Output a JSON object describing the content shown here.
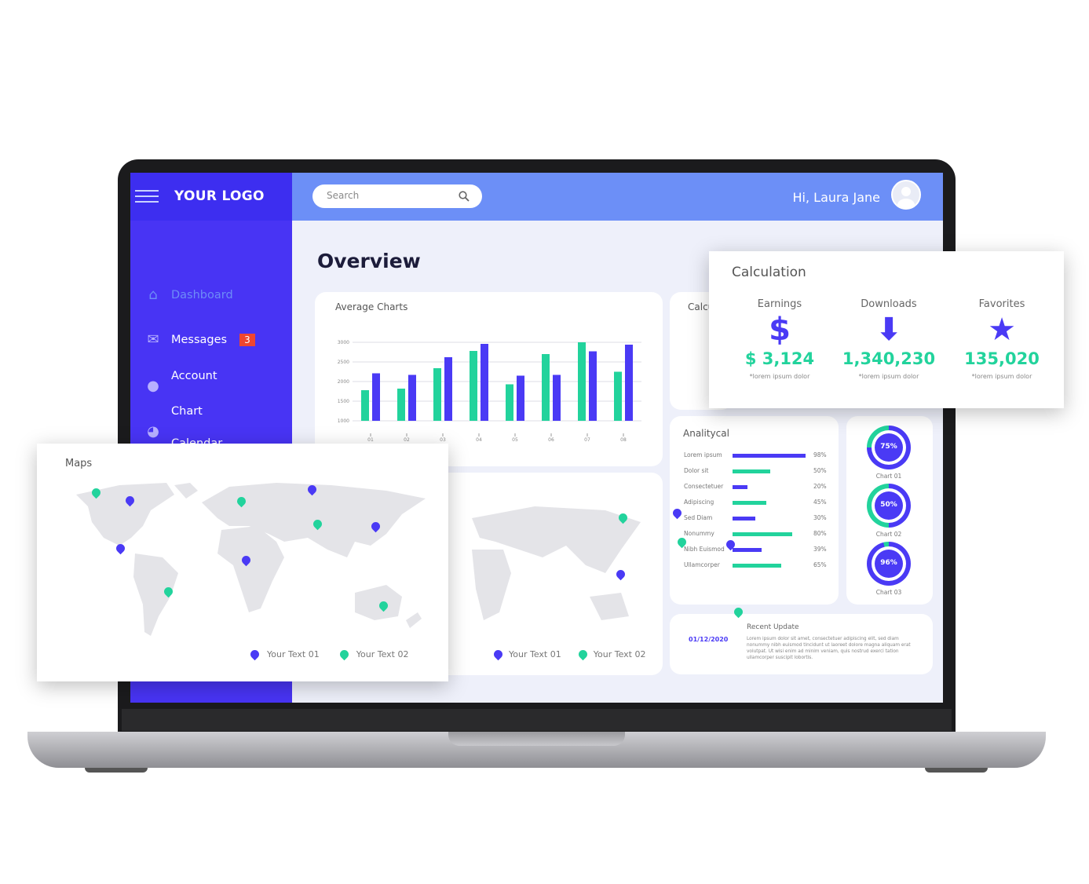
{
  "colors": {
    "primary": "#4a3af5",
    "accent": "#22d39c",
    "sidebar": "#4834f4",
    "topbar": "#6c8ff7",
    "badge": "#f0452f"
  },
  "header": {
    "logo": "YOUR LOGO",
    "search_placeholder": "Search",
    "greeting": "Hi, Laura Jane"
  },
  "sidebar": {
    "items": [
      {
        "label": "Dashboard",
        "icon": "home-icon"
      },
      {
        "label": "Messages",
        "icon": "mail-icon",
        "badge": "3"
      },
      {
        "label": "Account",
        "icon": "user-icon"
      },
      {
        "label": "Chart",
        "icon": "pie-chart-icon"
      },
      {
        "label": "Calendar",
        "icon": "calendar-icon"
      }
    ]
  },
  "main": {
    "title": "Overview"
  },
  "average_chart": {
    "title": "Average Charts"
  },
  "chart_data": {
    "type": "bar",
    "title": "Average Charts",
    "categories": [
      "01",
      "02",
      "03",
      "04",
      "05",
      "06",
      "07",
      "08"
    ],
    "series": [
      {
        "color": "#22d39c",
        "values": [
          1780,
          1820,
          2340,
          2780,
          1930,
          2700,
          3000,
          2250
        ]
      },
      {
        "color": "#4a3af5",
        "values": [
          2210,
          2170,
          2620,
          2960,
          2150,
          2170,
          2770,
          2940
        ]
      }
    ],
    "yticks": [
      3000,
      2500,
      2000,
      1500,
      1000
    ],
    "ylim": [
      1000,
      3000
    ],
    "grid": true
  },
  "calculation": {
    "title": "Calculation",
    "back_title": "Calcu",
    "items": [
      {
        "label": "Earnings",
        "icon": "dollar-icon",
        "glyph": "$",
        "value": "$ 3,124",
        "note": "*lorem ipsum dolor"
      },
      {
        "label": "Downloads",
        "icon": "download-arrow-icon",
        "glyph": "⬇",
        "value": "1,340,230",
        "note": "*lorem ipsum dolor"
      },
      {
        "label": "Favorites",
        "icon": "star-icon",
        "glyph": "★",
        "value": "135,020",
        "note": "*lorem ipsum dolor"
      }
    ]
  },
  "analytical": {
    "title": "Analitycal",
    "rows": [
      {
        "label": "Lorem ipsum",
        "value": 98,
        "text": "98%",
        "color": "#4a3af5"
      },
      {
        "label": "Dolor sit",
        "value": 50,
        "text": "50%",
        "color": "#22d39c"
      },
      {
        "label": "Consectetuer",
        "value": 20,
        "text": "20%",
        "color": "#4a3af5"
      },
      {
        "label": "Adipiscing",
        "value": 45,
        "text": "45%",
        "color": "#22d39c"
      },
      {
        "label": "Sed Diam",
        "value": 30,
        "text": "30%",
        "color": "#4a3af5"
      },
      {
        "label": "Nonummy",
        "value": 80,
        "text": "80%",
        "color": "#22d39c"
      },
      {
        "label": "Nibh Euismod",
        "value": 39,
        "text": "39%",
        "color": "#4a3af5"
      },
      {
        "label": "Ullamcorper",
        "value": 65,
        "text": "65%",
        "color": "#22d39c"
      }
    ]
  },
  "donuts": [
    {
      "label": "Chart 01",
      "value": 75,
      "text": "75%"
    },
    {
      "label": "Chart 02",
      "value": 50,
      "text": "50%"
    },
    {
      "label": "Chart 03",
      "value": 96,
      "text": "96%"
    }
  ],
  "recent": {
    "title": "Recent Update",
    "date": "01/12/2020",
    "body": "Lorem ipsum dolor sit amet, consectetuer adipiscing elit, sed diam nonummy nibh euismod tincidunt ut laoreet dolore magna aliquam erat volutpat. Ut wisi enim ad minim veniam, quis nostrud exerci tation ullamcorper suscipit lobortis."
  },
  "maps": {
    "title": "Maps",
    "legend": [
      {
        "label": "Your Text 01",
        "color": "#4a3af5"
      },
      {
        "label": "Your Text 02",
        "color": "#22d39c"
      }
    ]
  }
}
